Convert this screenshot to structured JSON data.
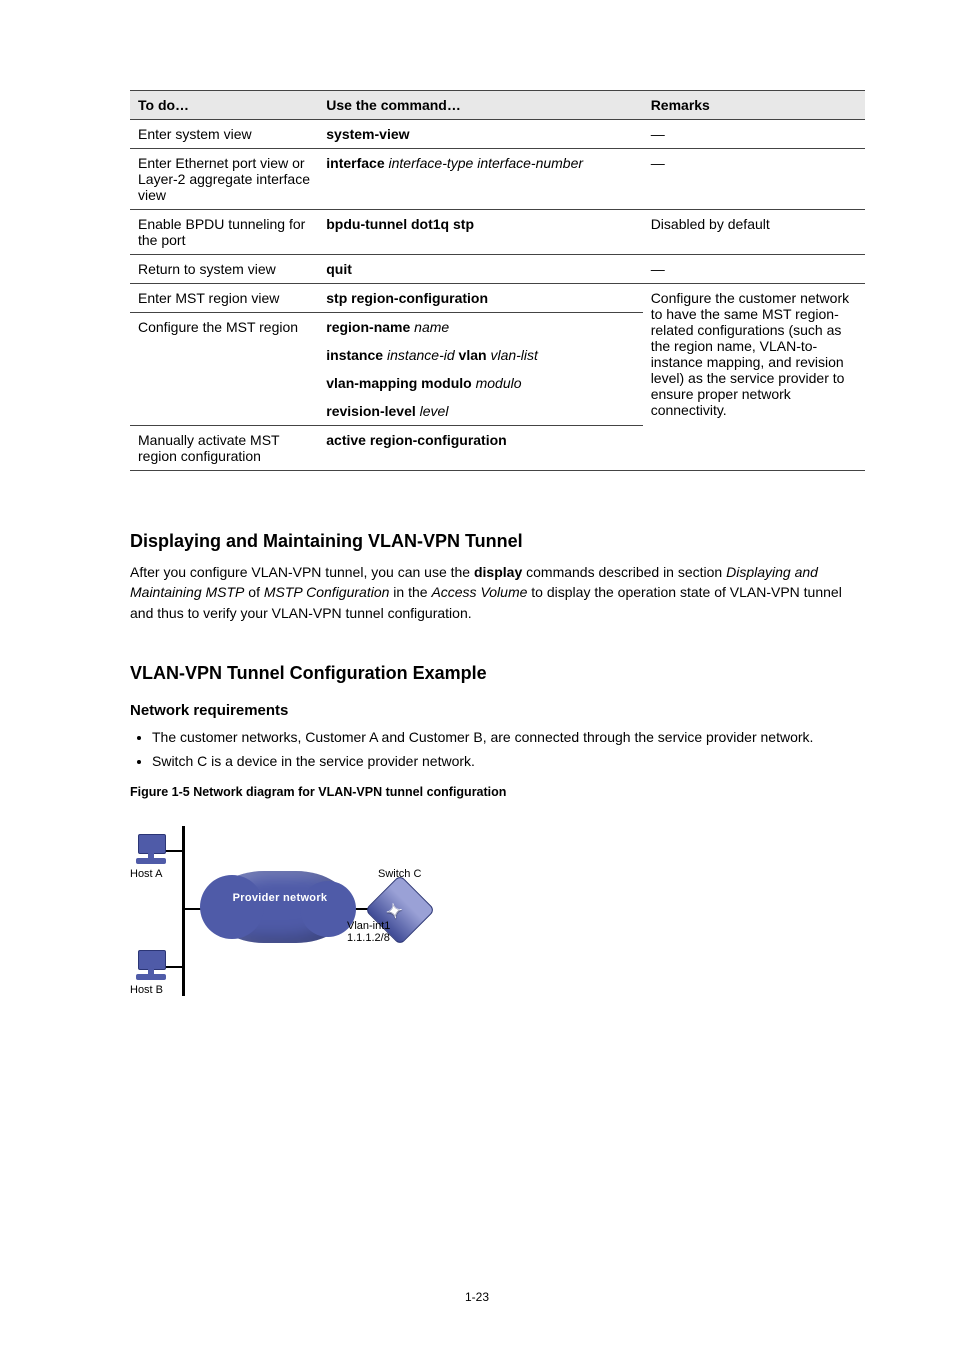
{
  "table": {
    "headers": [
      "To do…",
      "Use the command…",
      "Remarks"
    ],
    "rows": [
      {
        "cells": [
          "Enter system view",
          "system-view",
          "—"
        ]
      },
      {
        "cells": [
          "Enter Ethernet port view or Layer-2 aggregate interface view",
          "interface interface-type interface-number",
          "—"
        ]
      },
      {
        "cells": [
          "Enable BPDU tunneling for the port",
          "bpdu-tunnel dot1q stp",
          "Disabled by default"
        ]
      },
      {
        "cells": [
          "Return to system view",
          "quit",
          "—"
        ]
      },
      {
        "cells": [
          "Enter MST region view",
          "stp region-configuration",
          ""
        ]
      },
      {
        "cells": [
          "Configure the MST region",
          "region-name name",
          ""
        ]
      },
      {
        "cells": [
          "",
          "instance instance-id vlan vlan-list",
          ""
        ],
        "merged": true
      },
      {
        "cells": [
          "",
          "vlan-mapping modulo modulo",
          ""
        ],
        "merged": true
      },
      {
        "cells": [
          "",
          "revision-level level",
          ""
        ],
        "merged": true
      },
      {
        "cells": [
          "Manually activate MST region configuration",
          "active region-configuration",
          ""
        ]
      }
    ],
    "remark_block": "Configure the customer network to have the same MST region-related configurations (such as the region name, VLAN-to-instance mapping, and revision level) as the service provider to ensure proper network connectivity."
  },
  "section": {
    "title": "Displaying and Maintaining VLAN-VPN Tunnel",
    "text": "After you configure VLAN-VPN tunnel, you can use the display commands described in section Displaying and Maintaining MSTP of MSTP Configuration in the Access Volume to display the operation state of VLAN-VPN tunnel and thus to verify your VLAN-VPN tunnel configuration."
  },
  "example": {
    "title": "VLAN-VPN Tunnel Configuration Example",
    "req_title": "Network requirements",
    "bullets": [
      "The customer networks, Customer A and Customer B, are connected through the service provider network.",
      "Switch C is a device in the service provider network."
    ],
    "fig_caption": "Figure 1-5 Network diagram for VLAN-VPN tunnel configuration"
  },
  "diagram": {
    "hostA": "Host A",
    "hostB": "Host B",
    "cloud": "Provider network",
    "switchC": "Switch C",
    "vlan1": "Vlan-int1",
    "ip": "1.1.1.2/8"
  },
  "pageNumber": "1-23"
}
